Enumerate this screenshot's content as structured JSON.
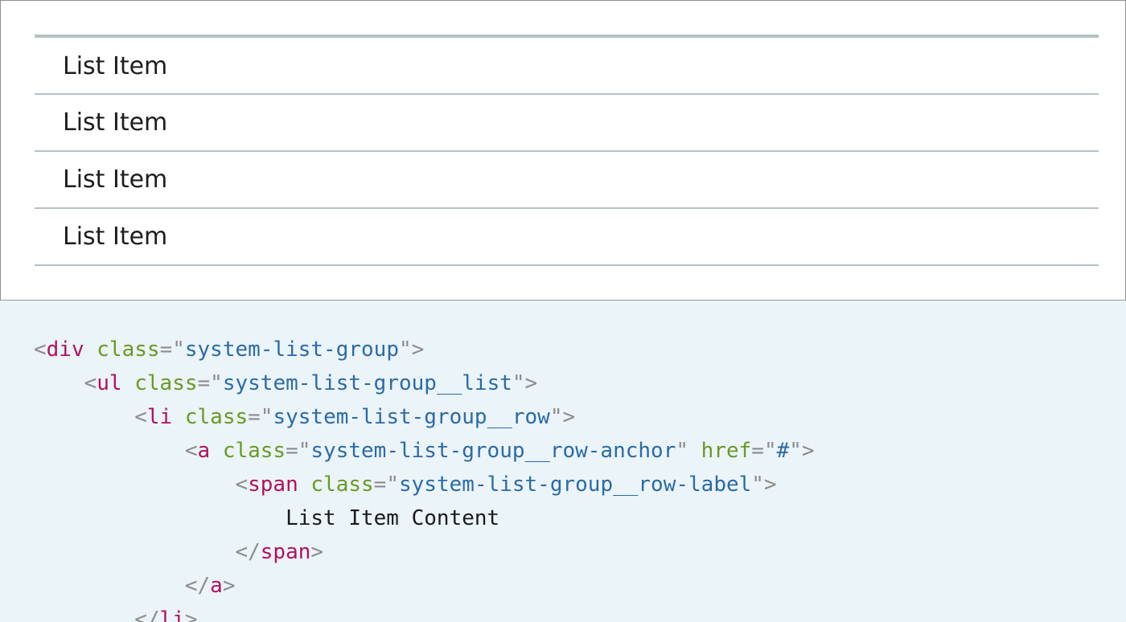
{
  "preview": {
    "items": [
      {
        "label": "List Item"
      },
      {
        "label": "List Item"
      },
      {
        "label": "List Item"
      },
      {
        "label": "List Item"
      }
    ]
  },
  "code": {
    "lines": [
      {
        "indent": "",
        "parts": [
          [
            "punct",
            "<"
          ],
          [
            "tag",
            "div"
          ],
          [
            "txt",
            " "
          ],
          [
            "attr",
            "class"
          ],
          [
            "punct",
            "=\""
          ],
          [
            "str",
            "system-list-group"
          ],
          [
            "punct",
            "\">"
          ]
        ]
      },
      {
        "indent": "    ",
        "parts": [
          [
            "punct",
            "<"
          ],
          [
            "tag",
            "ul"
          ],
          [
            "txt",
            " "
          ],
          [
            "attr",
            "class"
          ],
          [
            "punct",
            "=\""
          ],
          [
            "str",
            "system-list-group__list"
          ],
          [
            "punct",
            "\">"
          ]
        ]
      },
      {
        "indent": "        ",
        "parts": [
          [
            "punct",
            "<"
          ],
          [
            "tag",
            "li"
          ],
          [
            "txt",
            " "
          ],
          [
            "attr",
            "class"
          ],
          [
            "punct",
            "=\""
          ],
          [
            "str",
            "system-list-group__row"
          ],
          [
            "punct",
            "\">"
          ]
        ]
      },
      {
        "indent": "            ",
        "parts": [
          [
            "punct",
            "<"
          ],
          [
            "tag",
            "a"
          ],
          [
            "txt",
            " "
          ],
          [
            "attr",
            "class"
          ],
          [
            "punct",
            "=\""
          ],
          [
            "str",
            "system-list-group__row-anchor"
          ],
          [
            "punct",
            "\" "
          ],
          [
            "attr",
            "href"
          ],
          [
            "punct",
            "=\""
          ],
          [
            "str",
            "#"
          ],
          [
            "punct",
            "\">"
          ]
        ]
      },
      {
        "indent": "                ",
        "parts": [
          [
            "punct",
            "<"
          ],
          [
            "tag",
            "span"
          ],
          [
            "txt",
            " "
          ],
          [
            "attr",
            "class"
          ],
          [
            "punct",
            "=\""
          ],
          [
            "str",
            "system-list-group__row-label"
          ],
          [
            "punct",
            "\">"
          ]
        ]
      },
      {
        "indent": "                    ",
        "parts": [
          [
            "txt",
            "List Item Content"
          ]
        ]
      },
      {
        "indent": "                ",
        "parts": [
          [
            "punct",
            "</"
          ],
          [
            "tag",
            "span"
          ],
          [
            "punct",
            ">"
          ]
        ]
      },
      {
        "indent": "            ",
        "parts": [
          [
            "punct",
            "</"
          ],
          [
            "tag",
            "a"
          ],
          [
            "punct",
            ">"
          ]
        ]
      },
      {
        "indent": "        ",
        "parts": [
          [
            "punct",
            "</"
          ],
          [
            "tag",
            "li"
          ],
          [
            "punct",
            ">"
          ]
        ]
      }
    ]
  }
}
